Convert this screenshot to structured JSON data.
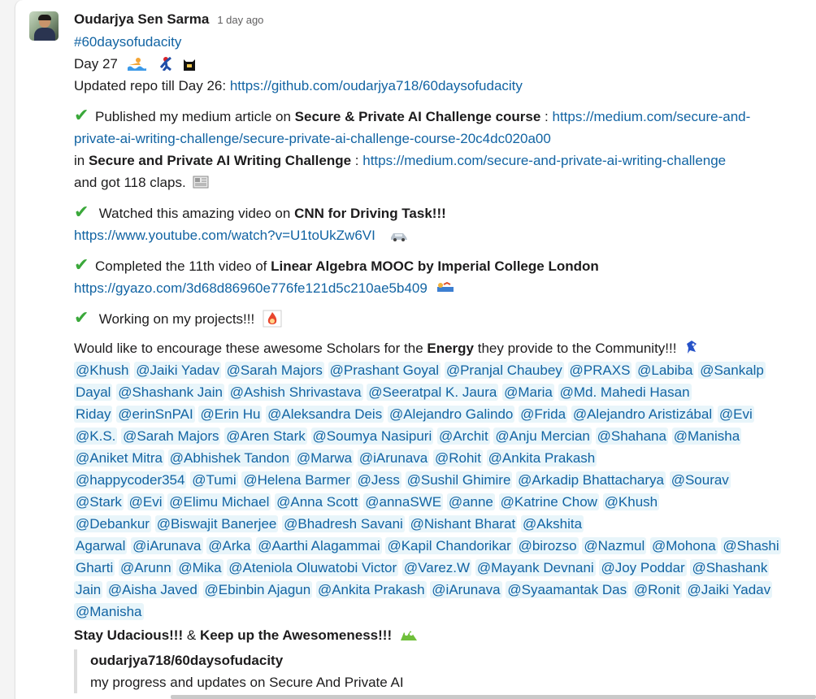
{
  "post": {
    "author": "Oudarjya Sen Sarma",
    "time": "1 day ago",
    "hashtag": "#60daysofudacity",
    "day": "Day 27",
    "repo_prefix": "Updated repo till Day 26: ",
    "repo_link": "https://github.com/oudarjya718/60daysofudacity",
    "item1": {
      "prefix": "Published my medium article on ",
      "bold": "Secure & Private AI Challenge course",
      "sep": " : ",
      "link_a": "https://medium.com/secure-and-",
      "link_b": "private-ai-writing-challenge/secure-private-ai-challenge-course-20c4dc020a00",
      "in_prefix": "in ",
      "bold2": "Secure and Private AI Writing Challenge",
      "sep2": " : ",
      "link2": "https://medium.com/secure-and-private-ai-writing-challenge",
      "suffix": "and got 118 claps."
    },
    "item2": {
      "prefix": "Watched this amazing video on ",
      "bold": "CNN for Driving Task!!!",
      "link": "https://www.youtube.com/watch?v=U1toUkZw6VI"
    },
    "item3": {
      "prefix": "Completed the 11th video of ",
      "bold": "Linear Algebra MOOC by Imperial College London",
      "link": "https://gyazo.com/3d68d86960e776fe121d5c210ae5b409"
    },
    "item4": {
      "text": "Working on my projects!!!"
    },
    "encourage": {
      "prefix": "Would like to encourage these awesome Scholars for the ",
      "bold": "Energy",
      "suffix": " they provide to the Community!!!"
    },
    "mention_lines": [
      [
        "@Khush",
        "@Jaiki Yadav",
        "@Sarah Majors",
        "@Prashant Goyal",
        "@Pranjal Chaubey",
        "@PRAXS",
        "@Labiba",
        "@Sankalp"
      ],
      [
        "Dayal",
        "@Shashank Jain",
        "@Ashish Shrivastava",
        "@Seeratpal K. Jaura",
        "@Maria",
        "@Md. Mahedi Hasan"
      ],
      [
        "Riday",
        "@erinSnPAI",
        "@Erin Hu",
        "@Aleksandra Deis",
        "@Alejandro Galindo",
        "@Frida",
        "@Alejandro Aristizábal",
        "@Evi"
      ],
      [
        "@K.S.",
        "@Sarah Majors",
        "@Aren Stark",
        "@Soumya Nasipuri",
        "@Archit",
        "@Anju Mercian",
        "@Shahana",
        "@Manisha"
      ],
      [
        "@Aniket Mitra",
        "@Abhishek Tandon",
        "@Marwa",
        "@iArunava",
        "@Rohit",
        "@Ankita Prakash"
      ],
      [
        "@happycoder354",
        "@Tumi",
        "@Helena Barmer",
        "@Jess",
        "@Sushil Ghimire",
        "@Arkadip Bhattacharya",
        "@Sourav"
      ],
      [
        "@Stark",
        "@Evi",
        "@Elimu Michael",
        "@Anna Scott",
        "@annaSWE",
        "@anne",
        "@Katrine Chow",
        "@Khush"
      ],
      [
        "@Debankur",
        "@Biswajit Banerjee",
        "@Bhadresh Savani",
        "@Nishant Bharat",
        "@Akshita"
      ],
      [
        "Agarwal",
        "@iArunava",
        "@Arka",
        "@Aarthi Alagammai",
        "@Kapil Chandorikar",
        "@birozso",
        "@Nazmul",
        "@Mohona",
        "@Shashi"
      ],
      [
        "Gharti",
        "@Arunn",
        "@Mika",
        "@Ateniola Oluwatobi Victor",
        "@Varez.W",
        "@Mayank Devnani",
        "@Joy Poddar",
        "@Shashank"
      ],
      [
        "Jain",
        "@Aisha Javed",
        "@Ebinbin Ajagun",
        "@Ankita Prakash",
        "@iArunava",
        "@Syaamantak Das",
        "@Ronit",
        "@Jaiki Yadav"
      ],
      [
        "@Manisha"
      ]
    ],
    "closing": {
      "bold1": "Stay Udacious!!!",
      "amp": " & ",
      "bold2": "Keep up the Awesomeness!!!"
    },
    "attachment": {
      "title": "oudarjya718/60daysofudacity",
      "desc": "my progress and updates on Secure And Private AI"
    }
  },
  "icons": {
    "check": "heavy-check-mark",
    "colors": {
      "link": "#1264a3",
      "mention_bg": "#e8f5fa",
      "check": "#3aa83a"
    }
  }
}
